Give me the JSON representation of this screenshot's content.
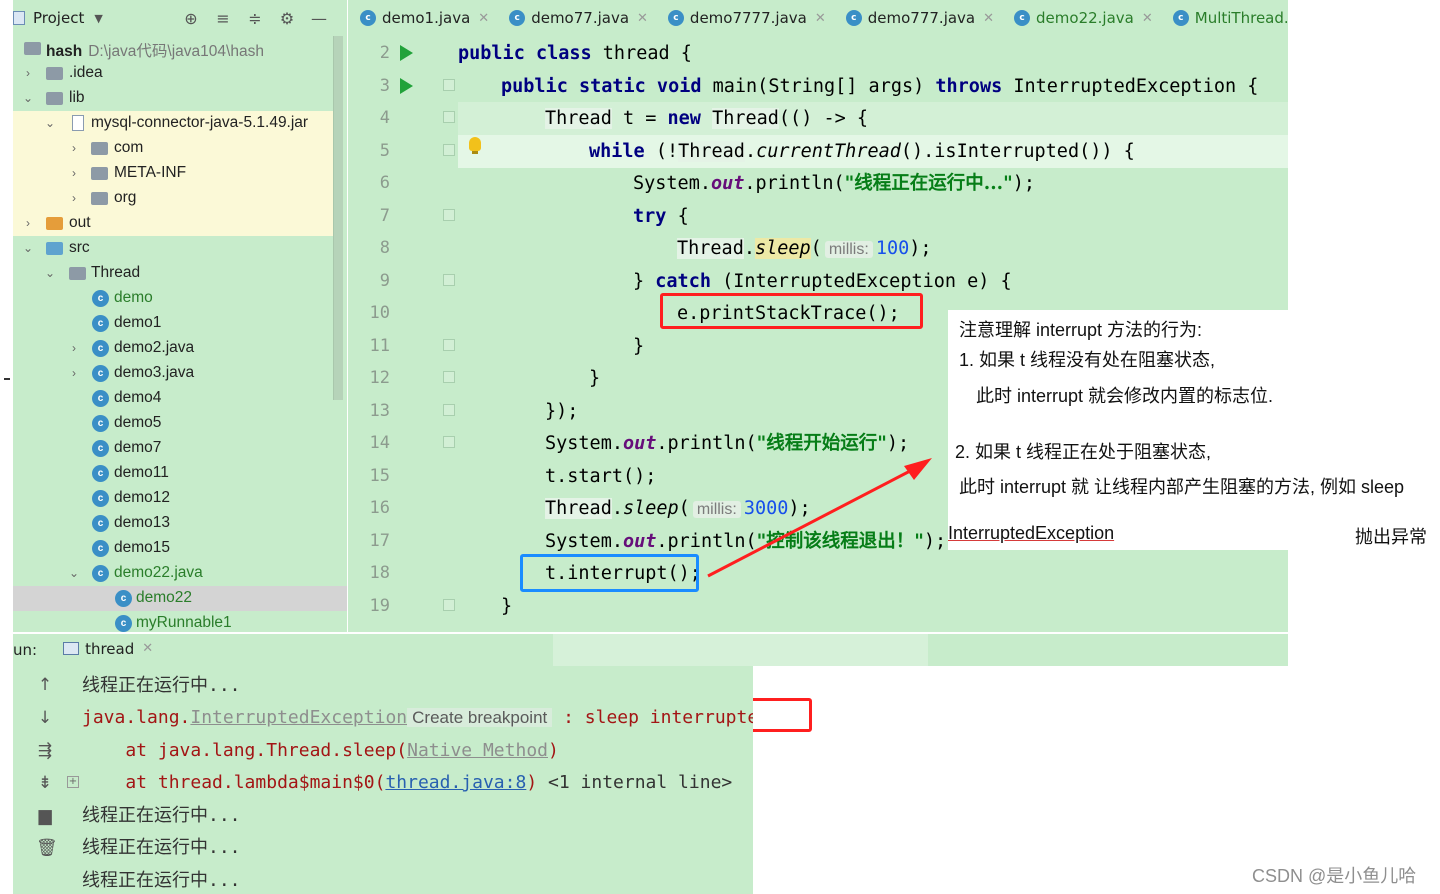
{
  "project": {
    "title": "Project",
    "root_name": "hash",
    "root_path": "D:\\java代码\\java104\\hash",
    "items": [
      {
        "label": "hash"
      },
      {
        "label": ".idea"
      },
      {
        "label": "lib"
      },
      {
        "label": "mysql-connector-java-5.1.49.jar"
      },
      {
        "label": "com"
      },
      {
        "label": "META-INF"
      },
      {
        "label": "org"
      },
      {
        "label": "out"
      },
      {
        "label": "src"
      },
      {
        "label": "Thread"
      },
      {
        "label": "demo"
      },
      {
        "label": "demo1"
      },
      {
        "label": "demo2.java"
      },
      {
        "label": "demo3.java"
      },
      {
        "label": "demo4"
      },
      {
        "label": "demo5"
      },
      {
        "label": "demo7"
      },
      {
        "label": "demo11"
      },
      {
        "label": "demo12"
      },
      {
        "label": "demo13"
      },
      {
        "label": "demo15"
      },
      {
        "label": "demo22.java"
      },
      {
        "label": "demo22"
      },
      {
        "label": "myRunnable1"
      }
    ]
  },
  "tabs": [
    "demo1.java",
    "demo77.java",
    "demo7777.java",
    "demo777.java",
    "demo22.java",
    "MultiThread.ja"
  ],
  "editor": {
    "line_numbers": [
      "2",
      "3",
      "4",
      "5",
      "6",
      "7",
      "8",
      "9",
      "10",
      "11",
      "12",
      "13",
      "14",
      "15",
      "16",
      "17",
      "18",
      "19"
    ],
    "lines": {
      "l2": {
        "a": "public class ",
        "b": "thread {"
      },
      "l3": {
        "a": "public static void ",
        "b": "main(String[] args) ",
        "c": "throws ",
        "d": "InterruptedException {"
      },
      "l4": {
        "a": "Thread",
        "b": " t = ",
        "c": "new ",
        "d": "Thread",
        "e": "(() -> {"
      },
      "l5": {
        "a": "while ",
        "b": "(!",
        "c": "Thread",
        "d": ".",
        "e": "currentThread",
        "f": "().isInterrupted()) {"
      },
      "l6": {
        "a": "System.",
        "b": "out",
        "c": ".println(",
        "d": "\"线程正在运行中...\"",
        "e": ");"
      },
      "l7": {
        "a": "try ",
        "b": "{"
      },
      "l8": {
        "a": "Thread",
        "b": ".",
        "c": "sleep",
        "d": "(",
        "hint": "millis:",
        "e": "100",
        "f": ");"
      },
      "l9": {
        "a": "} ",
        "b": "catch ",
        "c": "(InterruptedException e) {"
      },
      "l10": {
        "a": "e.printStackTrace();"
      },
      "l11": {
        "a": "}"
      },
      "l12": {
        "a": "}"
      },
      "l13": {
        "a": "});"
      },
      "l14": {
        "a": "System.",
        "b": "out",
        "c": ".println(",
        "d": "\"线程开始运行\"",
        "e": ");"
      },
      "l15": {
        "a": "t.start();"
      },
      "l16": {
        "a": "Thread",
        "b": ".",
        "c": "sleep",
        "d": "(",
        "hint": "millis:",
        "e": "3000",
        "f": ");"
      },
      "l17": {
        "a": "System.",
        "b": "out",
        "c": ".println(",
        "d": "\"控制该线程退出！\"",
        "e": ");"
      },
      "l18": {
        "a": "t.interrupt();"
      },
      "l19": {
        "a": "}"
      }
    }
  },
  "annotation": {
    "title": "注意理解 interrupt 方法的行为:",
    "p1": "1. 如果 t 线程没有处在阻塞状态,",
    "p1b": "此时 interrupt 就会修改内置的标志位.",
    "p2": "2. 如果 t 线程正在处于阻塞状态,",
    "p2b": "此时 interrupt 就 让线程内部产生阻塞的方法, 例如 sleep",
    "p3": "InterruptedException",
    "p3b": "抛出异常"
  },
  "run": {
    "label": "un:",
    "tab": "thread",
    "console": {
      "c1": "线程正在运行中...",
      "c2a": "java.lang.",
      "c2b": "InterruptedException",
      "c2c": "Create breakpoint",
      "c2d": " : sleep interrupted",
      "c3a": "    at java.lang.Thread.sleep(",
      "c3b": "Native Method",
      "c3c": ")",
      "c4a": "    at thread.lambda$main$0(",
      "c4b": "thread.java:8",
      "c4c": ")",
      "c4d": " <1 internal line>",
      "c5": "线程正在运行中...",
      "c6": "线程正在运行中...",
      "c7": "线程正在运行中..."
    }
  },
  "watermark": "CSDN @是小鱼儿哈",
  "colors": {
    "ide_background": "#c7eccb",
    "red_highlight": "#ff1f1f",
    "blue_highlight": "#1a8cff"
  }
}
